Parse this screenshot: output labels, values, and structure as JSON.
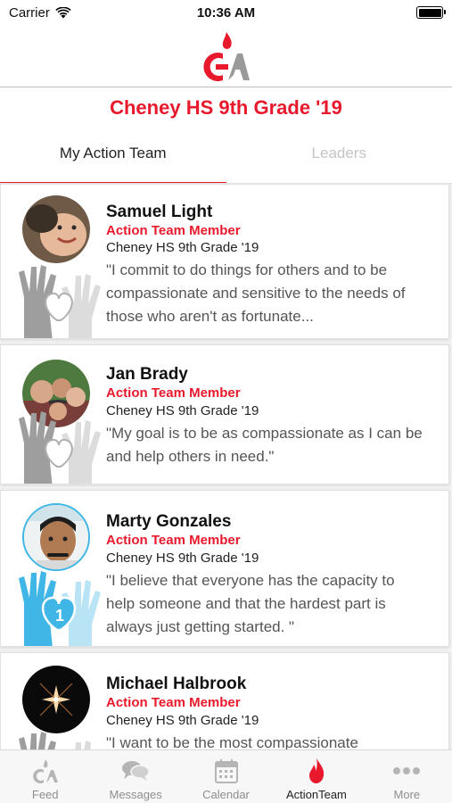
{
  "status": {
    "carrier": "Carrier",
    "time": "10:36 AM",
    "battery_level": 1.0
  },
  "header": {
    "logo_name": "ga-flame-logo",
    "title": "Cheney HS 9th Grade '19"
  },
  "tabs": [
    {
      "label": "My Action Team",
      "active": true
    },
    {
      "label": "Leaders",
      "active": false
    }
  ],
  "members": [
    {
      "name": "Samuel Light",
      "role": "Action Team Member",
      "school": "Cheney HS 9th Grade '19",
      "quote": "\"I commit to do things for others and to be compassionate and sensitive to the needs of those who aren't as fortunate...",
      "hearts": "",
      "hands_color": "gray"
    },
    {
      "name": "Jan Brady",
      "role": "Action Team Member",
      "school": "Cheney HS 9th Grade '19",
      "quote": "\"My goal is to be as compassionate as I can be and help others in need.\"",
      "hearts": "",
      "hands_color": "gray"
    },
    {
      "name": "Marty Gonzales",
      "role": "Action Team Member",
      "school": "Cheney HS 9th Grade '19",
      "quote": "\"I believe that everyone has the capacity to help someone and that the hardest part is always just getting started. \"",
      "hearts": "1",
      "hands_color": "blue"
    },
    {
      "name": "Michael Halbrook",
      "role": "Action Team Member",
      "school": "Cheney HS 9th Grade '19",
      "quote": "\"I want to be the most compassionate",
      "hearts": "",
      "hands_color": "gray"
    }
  ],
  "tabbar": [
    {
      "label": "Feed",
      "icon": "ga-logo-icon",
      "active": false
    },
    {
      "label": "Messages",
      "icon": "chat-bubbles-icon",
      "active": false
    },
    {
      "label": "Calendar",
      "icon": "calendar-icon",
      "active": false
    },
    {
      "label": "ActionTeam",
      "icon": "flame-icon",
      "active": true
    },
    {
      "label": "More",
      "icon": "more-dots-icon",
      "active": false
    }
  ],
  "colors": {
    "brand_red": "#e8192c",
    "hands_gray": "#9e9e9e",
    "hands_blue": "#3fb6e6"
  }
}
